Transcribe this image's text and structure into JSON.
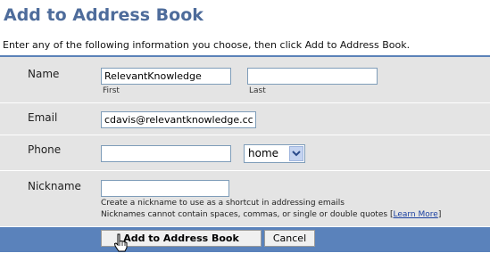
{
  "header": {
    "title": "Add to Address Book",
    "subtitle": "Enter any of the following information you choose, then click Add to Address Book."
  },
  "form": {
    "name": {
      "label": "Name",
      "first_value": "RelevantKnowledge",
      "last_value": "",
      "first_hint": "First",
      "last_hint": "Last"
    },
    "email": {
      "label": "Email",
      "value": "cdavis@relevantknowledge.cc"
    },
    "phone": {
      "label": "Phone",
      "value": "",
      "type_selected": "home"
    },
    "nickname": {
      "label": "Nickname",
      "value": "",
      "help_line1": "Create a nickname to use as a shortcut in addressing emails",
      "help_line2": "Nicknames cannot contain spaces, commas, or single or double quotes",
      "learn_more_open": "[",
      "learn_more": "Learn More",
      "learn_more_close": "]"
    }
  },
  "buttons": {
    "add_label": "Add to Address Book",
    "cancel_label": "Cancel"
  },
  "icons": {
    "dropdown": "chevron-down-icon",
    "cursor": "hand-pointer-icon"
  },
  "colors": {
    "title": "#4e6c9b",
    "accent": "#5a82bb",
    "form_bg": "#e4e4e4",
    "link": "#1a3fa0"
  }
}
